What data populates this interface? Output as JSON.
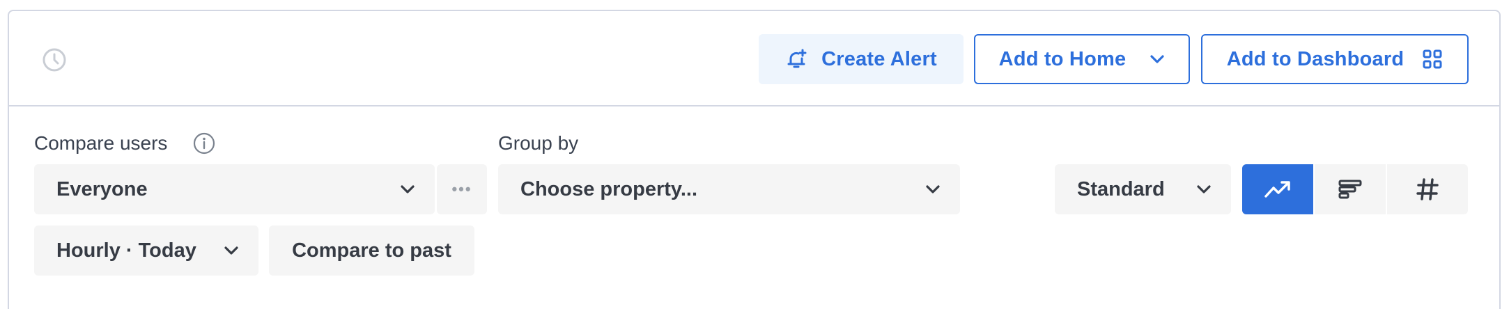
{
  "header": {
    "create_alert_label": "Create Alert",
    "add_home_label": "Add to Home",
    "add_dashboard_label": "Add to Dashboard"
  },
  "filters": {
    "compare_label": "Compare users",
    "compare_value": "Everyone",
    "more_label": "•••",
    "group_label": "Group by",
    "group_value": "Choose property...",
    "mode_value": "Standard",
    "interval_value": "Hourly · Today",
    "compare_past_label": "Compare to past"
  },
  "chart_types": [
    {
      "icon": "line-chart-icon",
      "active": true
    },
    {
      "icon": "bar-chart-icon",
      "active": false
    },
    {
      "icon": "number-icon",
      "active": false
    }
  ],
  "colors": {
    "accent": "#2d6fdc",
    "border": "#d3d7e3",
    "field_bg": "#f5f5f5",
    "alert_bg": "#eef5fd"
  }
}
